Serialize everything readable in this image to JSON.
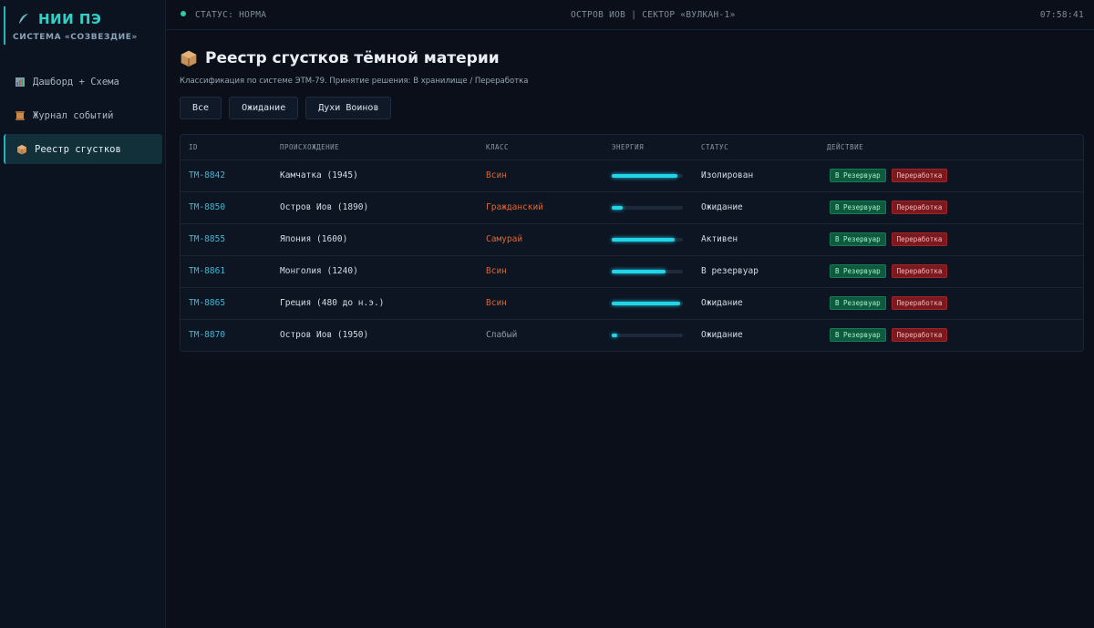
{
  "brand": {
    "title": "НИИ ПЭ",
    "subtitle": "СИСТЕМА «СОЗВЕЗДИЕ»",
    "icon": "feather-icon"
  },
  "sidebar": {
    "items": [
      {
        "label": "Дашборд + Схема",
        "icon": "chart-icon",
        "active": false
      },
      {
        "label": "Журнал событий",
        "icon": "scroll-icon",
        "active": false
      },
      {
        "label": "Реестр сгустков",
        "icon": "box-icon",
        "active": true
      }
    ]
  },
  "topbar": {
    "status": "СТАТУС: НОРМА",
    "location": "ОСТРОВ ИОВ | СЕКТОР «ВУЛКАН-1»",
    "clock": "07:58:41"
  },
  "page": {
    "title": "Реестр сгустков тёмной материи",
    "subtitle": "Классификация по системе ЭТМ-79. Принятие решения: В хранилище / Переработка",
    "title_icon": "box-icon"
  },
  "filters": [
    "Все",
    "Ожидание",
    "Духи Воинов"
  ],
  "table": {
    "headers": {
      "id": "ID",
      "origin": "ПРОИСХОЖДЕНИЕ",
      "class": "КЛАСС",
      "energy": "ЭНЕРГИЯ",
      "status": "СТАТУС",
      "action": "ДЕЙСТВИЕ"
    },
    "store_label": "В Резервуар",
    "process_label": "Переработка",
    "rows": [
      {
        "id": "TM-8842",
        "origin": "Камчатка (1945)",
        "class": "Всин",
        "energy": 0.92,
        "status": "Изолирован"
      },
      {
        "id": "TM-8850",
        "origin": "Остров Иов (1890)",
        "class": "Гражданский",
        "energy": 0.15,
        "status": "Ожидание"
      },
      {
        "id": "TM-8855",
        "origin": "Япония (1600)",
        "class": "Самурай",
        "energy": 0.88,
        "status": "Активен"
      },
      {
        "id": "TM-8861",
        "origin": "Монголия (1240)",
        "class": "Всин",
        "energy": 0.76,
        "status": "В резервуар"
      },
      {
        "id": "TM-8865",
        "origin": "Греция (480 до н.э.)",
        "class": "Всин",
        "energy": 0.96,
        "status": "Ожидание"
      },
      {
        "id": "TM-8870",
        "origin": "Остров Иов (1950)",
        "class": "Слабый",
        "energy": 0.08,
        "status": "Ожидание"
      }
    ]
  },
  "colors": {
    "accent": "#2ed3c8",
    "class_highlight": "#e0652c",
    "class_weak": "#8c98a6",
    "energy_fill": "#22d4ea"
  }
}
